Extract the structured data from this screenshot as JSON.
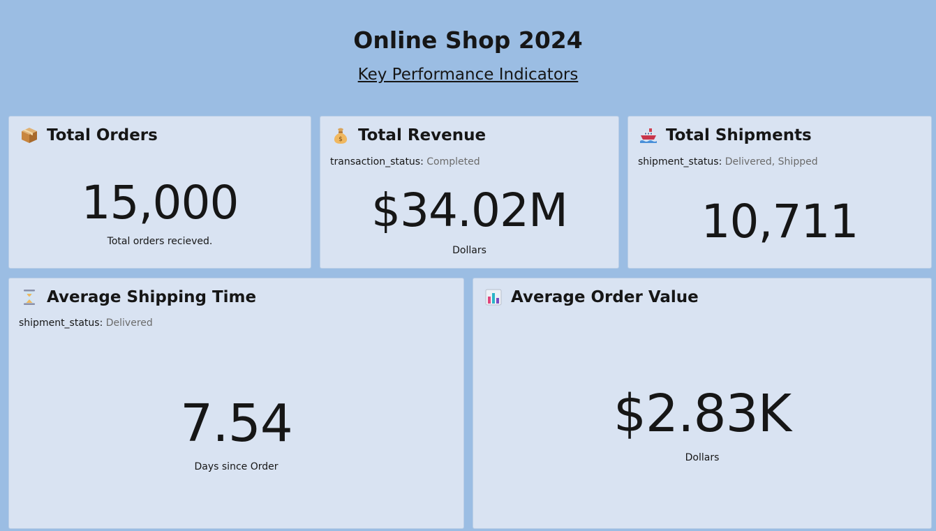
{
  "header": {
    "title": "Online Shop 2024",
    "subtitle": "Key Performance Indicators"
  },
  "cards": {
    "orders": {
      "title": "Total Orders",
      "icon": "package-icon",
      "value": "15,000",
      "caption": "Total orders recieved."
    },
    "revenue": {
      "title": "Total Revenue",
      "icon": "money-bag-icon",
      "filter_key": "transaction_status:",
      "filter_value": "Completed",
      "value": "$34.02M",
      "caption": "Dollars"
    },
    "shipments": {
      "title": "Total Shipments",
      "icon": "ship-icon",
      "filter_key": "shipment_status:",
      "filter_value": "Delivered, Shipped",
      "value": "10,711"
    },
    "shipping_time": {
      "title": "Average Shipping Time",
      "icon": "hourglass-icon",
      "filter_key": "shipment_status:",
      "filter_value": "Delivered",
      "value": "7.54",
      "caption": "Days since Order"
    },
    "order_value": {
      "title": "Average Order Value",
      "icon": "bar-chart-icon",
      "value": "$2.83K",
      "caption": "Dollars"
    }
  },
  "colors": {
    "background": "#9bbde3",
    "card": "#d9e3f2",
    "text": "#161616",
    "muted": "#6b6b6b"
  }
}
